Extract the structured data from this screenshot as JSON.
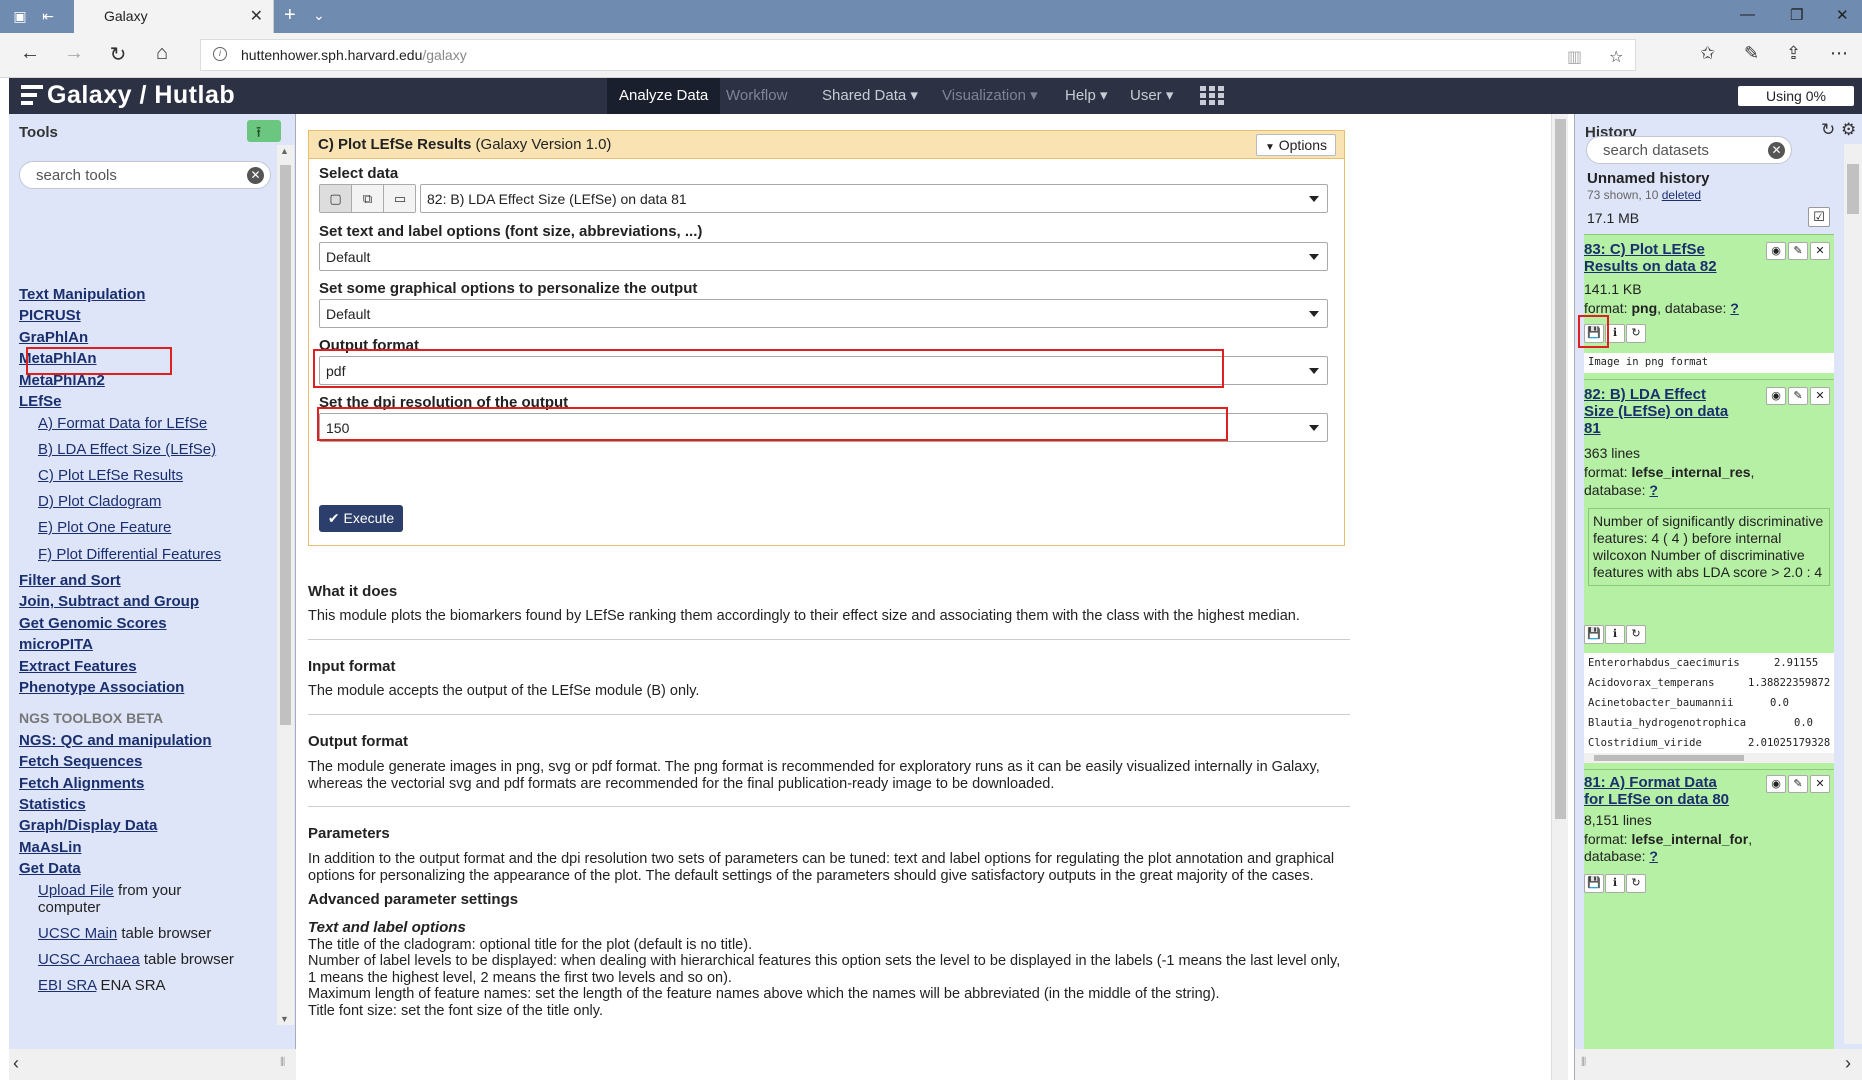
{
  "browser": {
    "tab_title": "Galaxy",
    "url_host": "huttenhower.sph.harvard.edu",
    "url_path": "/galaxy"
  },
  "masthead": {
    "brand": "Galaxy / Hutlab",
    "nav": [
      {
        "label": "Analyze Data"
      },
      {
        "label": "Workflow"
      },
      {
        "label": "Shared Data ▾"
      },
      {
        "label": "Visualization ▾"
      },
      {
        "label": "Help ▾"
      },
      {
        "label": "User ▾"
      }
    ],
    "quota": "Using 0%"
  },
  "tools": {
    "title": "Tools",
    "search_placeholder": "search tools",
    "items": {
      "text_manipulation": "Text Manipulation",
      "picrust": "PICRUSt",
      "graphlan": "GraPhlAn",
      "metaphlan": "MetaPhlAn",
      "metaphlan2": "MetaPhlAn2",
      "lefse": "LEfSe",
      "lefse_a": "A) Format Data for LEfSe",
      "lefse_b": "B) LDA Effect Size (LEfSe)",
      "lefse_c": "C) Plot LEfSe Results",
      "lefse_d": "D) Plot Cladogram",
      "lefse_e": "E) Plot One Feature",
      "lefse_f": "F) Plot Differential Features",
      "filter_sort": "Filter and Sort",
      "join": "Join, Subtract and Group",
      "genomic": "Get Genomic Scores",
      "micropita": "microPITA",
      "extract": "Extract Features",
      "phenotype": "Phenotype Association",
      "ngs_label": "NGS TOOLBOX BETA",
      "ngs_qc": "NGS: QC and manipulation",
      "fetch_seq": "Fetch Sequences",
      "fetch_align": "Fetch Alignments",
      "statistics": "Statistics",
      "graph_display": "Graph/Display Data",
      "maaslin": "MaAsLin",
      "get_data": "Get Data",
      "upload_link": "Upload File",
      "upload_rest": " from your",
      "upload_rest2": "computer",
      "ucsc_main_link": "UCSC Main",
      "ucsc_main_rest": " table browser",
      "ucsc_arch_link": "UCSC Archaea",
      "ucsc_arch_rest": " table browser",
      "ebi_link": "EBI SRA",
      "ebi_rest": " ENA SRA"
    }
  },
  "form": {
    "title_bold": "C) Plot LEfSe Results",
    "title_version": " (Galaxy Version 1.0)",
    "options_label": "Options",
    "select_data_label": "Select data",
    "select_data_value": "82: B) LDA Effect Size (LEfSe) on data 81",
    "text_opts_label": "Set text and label options (font size, abbreviations, ...)",
    "text_opts_value": "Default",
    "graph_opts_label": "Set some graphical options to personalize the output",
    "graph_opts_value": "Default",
    "output_format_label": "Output format",
    "output_format_value": "pdf",
    "dpi_label": "Set the dpi resolution of the output",
    "dpi_value": "150",
    "execute_label": "Execute"
  },
  "help": {
    "what_h": "What it does",
    "what_p": "This module plots the biomarkers found by LEfSe ranking them accordingly to their effect size and associating them with the class with the highest median.",
    "input_h": "Input format",
    "input_p": "The module accepts the output of the LEfSe module (B) only.",
    "output_h": "Output format",
    "output_p": "The module generate images in png, svg or pdf format. The png format is recommended for exploratory runs as it can be easily visualized internally in Galaxy, whereas the vectorial svg and pdf formats are recommended for the final publication-ready image to be downloaded.",
    "params_h": "Parameters",
    "params_p": "In addition to the output format and the dpi resolution two sets of parameters can be tuned: text and label options for regulating the plot annotation and graphical options for personalizing the appearance of the plot. The default settings of the parameters should give satisfactory outputs in the great majority of the cases.",
    "adv_h": "Advanced parameter settings",
    "text_label_h": "Text and label options",
    "line1": "The title of the cladogram: optional title for the plot (default is no title).",
    "line2": "Number of label levels to be displayed: when dealing with hierarchical features this option sets the level to be displayed in the labels (-1 means the last level only, 1 means the highest level, 2 means the first two levels and so on).",
    "line3": "Maximum length of feature names: set the length of the feature names above which the names will be abbreviated (in the middle of the string).",
    "line4": "Title font size: set the font size of the title only."
  },
  "history": {
    "title": "History",
    "search_placeholder": "search datasets",
    "name": "Unnamed history",
    "shown": "73 shown, 10 ",
    "deleted": "deleted",
    "size": "17.1 MB",
    "datasets": {
      "d83": {
        "title": "83: C) Plot LEfSe Results on data 82",
        "size": "141.1 KB",
        "format_label": "format: ",
        "format": "png",
        "db_label": ", database: ",
        "db": "?",
        "peek": "Image in png format"
      },
      "d82": {
        "title": "82: B) LDA Effect Size (LEfSe) on data 81",
        "size": "363 lines",
        "format_label": "format: ",
        "format": "lefse_internal_res",
        "format_suffix": ",",
        "db_label": "database: ",
        "db": "?",
        "info": "Number of significantly discriminative features: 4 ( 4 ) before internal wilcoxon Number of discriminative features with abs LDA score > 2.0 : 4",
        "peek_rows": [
          {
            "name": "Enterorhabdus_caecimuris",
            "value": "2.91155"
          },
          {
            "name": "Acidovorax_temperans",
            "value": "1.38822359872"
          },
          {
            "name": "Acinetobacter_baumannii",
            "value": "0.0"
          },
          {
            "name": "Blautia_hydrogenotrophica",
            "value": "0.0"
          },
          {
            "name": "Clostridium_viride",
            "value": "2.01025179328"
          }
        ]
      },
      "d81": {
        "title": "81: A) Format Data for LEfSe on data 80",
        "size": "8,151 lines",
        "format_label": "format: ",
        "format": "lefse_internal_for",
        "format_suffix": ",",
        "db_label": "database: ",
        "db": "?"
      }
    }
  }
}
